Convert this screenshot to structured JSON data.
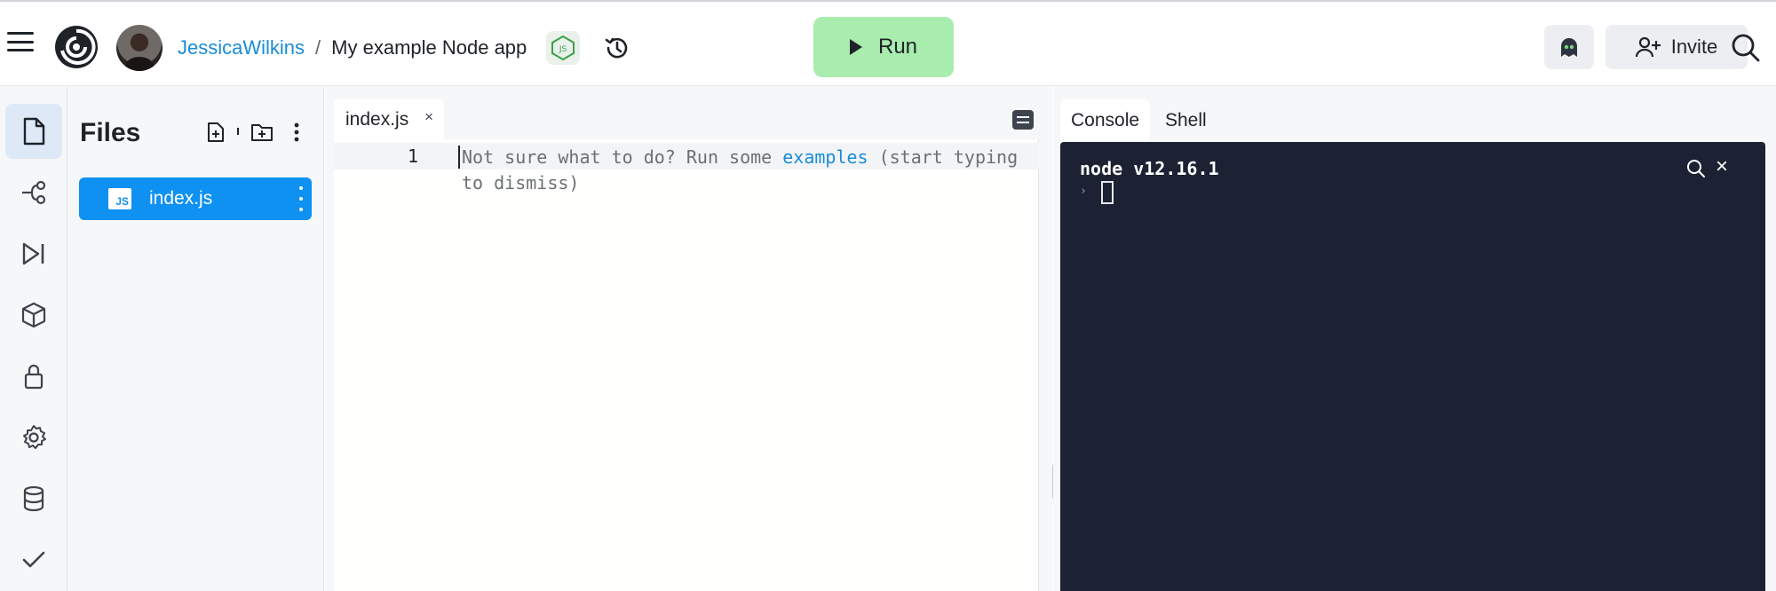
{
  "header": {
    "username": "JessicaWilkins",
    "separator": "/",
    "project_name": "My example Node app",
    "language_badge": "JS",
    "run_label": "Run",
    "invite_label": "Invite"
  },
  "icons": {
    "menu": "hamburger-icon",
    "logo": "replit-logo",
    "history": "history-icon",
    "run": "play-icon",
    "ghost": "ghostwriter-icon",
    "invite": "add-user-icon",
    "search": "search-icon"
  },
  "sidebar": {
    "items": [
      {
        "name": "files",
        "icon": "file-icon",
        "active": true
      },
      {
        "name": "version-control",
        "icon": "git-branch-icon",
        "active": false
      },
      {
        "name": "debugger",
        "icon": "step-play-icon",
        "active": false
      },
      {
        "name": "packages",
        "icon": "cube-icon",
        "active": false
      },
      {
        "name": "secrets",
        "icon": "lock-icon",
        "active": false
      },
      {
        "name": "settings",
        "icon": "gear-icon",
        "active": false
      },
      {
        "name": "database",
        "icon": "database-icon",
        "active": false
      },
      {
        "name": "unit-tests",
        "icon": "check-icon",
        "active": false
      }
    ]
  },
  "files_panel": {
    "title": "Files",
    "files": [
      {
        "name": "index.js",
        "type_badge": "JS",
        "selected": true
      }
    ]
  },
  "editor": {
    "tab_label": "index.js",
    "tab_close": "×",
    "line_number": "1",
    "hint_before": "Not sure what to do? Run some ",
    "hint_link": "examples",
    "hint_after": " (start typing to dismiss)"
  },
  "console": {
    "tabs": [
      "Console",
      "Shell"
    ],
    "active_tab": "Console",
    "version_line": "node v12.16.1",
    "prompt": "›",
    "close": "×"
  },
  "colors": {
    "accent_blue": "#0f91f2",
    "link_blue": "#1a8cd8",
    "run_green": "#a9edae",
    "console_bg": "#1c2233"
  }
}
